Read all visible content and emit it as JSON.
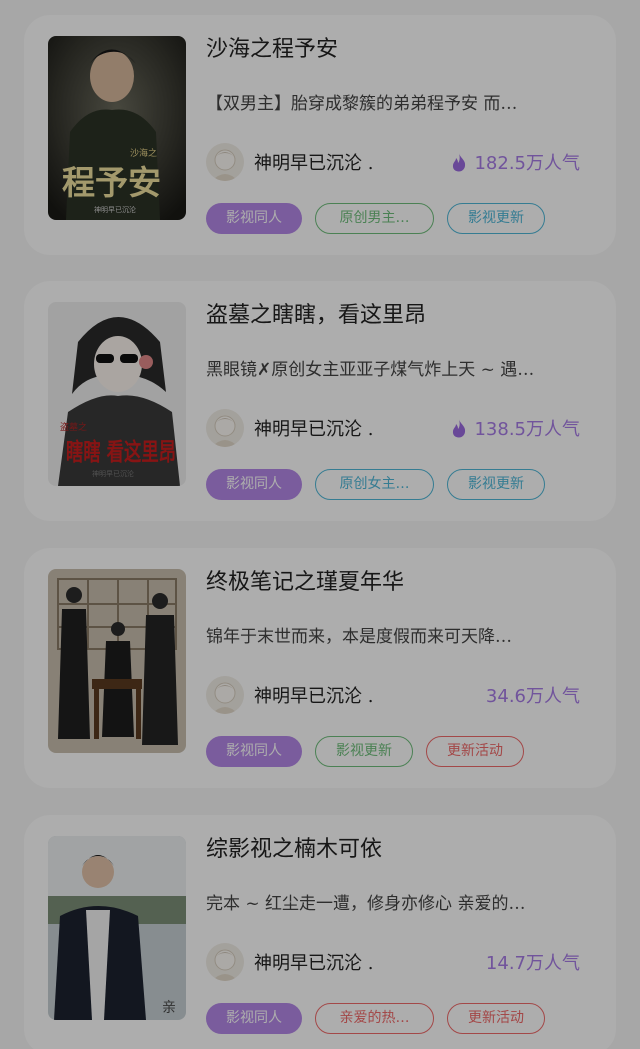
{
  "books": [
    {
      "title": "沙海之程予安",
      "description": "【双男主】胎穿成黎簇的弟弟程予安 而…",
      "author": "神明早已沉沦 .",
      "popularity": "182.5万人气",
      "hot": true,
      "cover": {
        "title": "程予安",
        "series": "沙海之",
        "author": "神明早已沉沦"
      },
      "tags": [
        {
          "label": "影视同人",
          "style": "filled",
          "color": "#b488e8"
        },
        {
          "label": "原创男主…",
          "style": "outline",
          "color": "#6fbf7c"
        },
        {
          "label": "影视更新",
          "style": "outline",
          "color": "#4fb7d8"
        }
      ]
    },
    {
      "title": "盗墓之瞎瞎，看这里昂",
      "description": "黑眼镜✗原创女主亚亚子煤气炸上天 ~ 遇…",
      "author": "神明早已沉沦 .",
      "popularity": "138.5万人气",
      "hot": true,
      "cover": {
        "title": "瞎瞎 看这里昂",
        "series": "盗墓之",
        "author": "神明早已沉沦"
      },
      "tags": [
        {
          "label": "影视同人",
          "style": "filled",
          "color": "#b488e8"
        },
        {
          "label": "原创女主…",
          "style": "outline",
          "color": "#4fb7d8"
        },
        {
          "label": "影视更新",
          "style": "outline",
          "color": "#4fb7d8"
        }
      ]
    },
    {
      "title": "终极笔记之瑾夏年华",
      "description": "锦年于末世而来，本是度假而来可天降…",
      "author": "神明早已沉沦 .",
      "popularity": "34.6万人气",
      "hot": false,
      "tags": [
        {
          "label": "影视同人",
          "style": "filled",
          "color": "#b488e8"
        },
        {
          "label": "影视更新",
          "style": "outline",
          "color": "#6fbf7c"
        },
        {
          "label": "更新活动",
          "style": "outline",
          "color": "#f06a6a"
        }
      ]
    },
    {
      "title": "综影视之楠木可依",
      "description": "完本 ~ 红尘走一遭，修身亦修心  亲爱的…",
      "author": "神明早已沉沦 .",
      "popularity": "14.7万人气",
      "hot": false,
      "cover": {
        "corner_text": "亲"
      },
      "tags": [
        {
          "label": "影视同人",
          "style": "filled",
          "color": "#b488e8"
        },
        {
          "label": "亲爱的热…",
          "style": "outline",
          "color": "#f06a6a"
        },
        {
          "label": "更新活动",
          "style": "outline",
          "color": "#f06a6a"
        }
      ]
    }
  ],
  "colors": {
    "popularity": "#a77ce6",
    "fire": "#9b6be0"
  }
}
